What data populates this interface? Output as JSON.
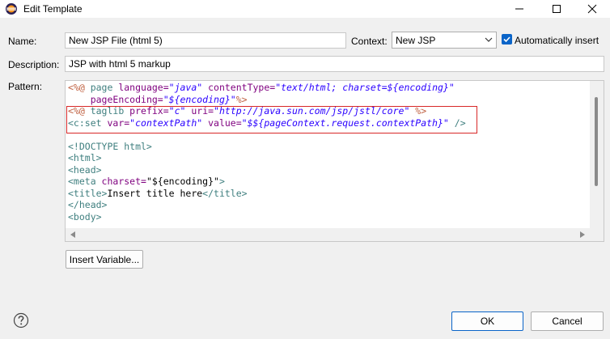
{
  "window": {
    "title": "Edit Template"
  },
  "form": {
    "name_label": "Name:",
    "name_value": "New JSP File (html 5)",
    "context_label": "Context:",
    "context_value": "New JSP",
    "auto_insert_label": "Automatically insert",
    "auto_insert_checked": true,
    "description_label": "Description:",
    "description_value": "JSP with html 5 markup",
    "pattern_label": "Pattern:"
  },
  "pattern": {
    "l1_open": "<%@",
    "l1_page": " page ",
    "l1_lang_attr": "language=",
    "l1_lang_val": "\"java\"",
    "l1_ct_attr": " contentType=",
    "l1_ct_val": "\"text/html; charset=${encoding}\"",
    "l2_indent": "    ",
    "l2_pe_attr": "pageEncoding=",
    "l2_pe_val": "\"${encoding}\"",
    "l2_close": "%>",
    "l3_open": "<%@",
    "l3_taglib": " taglib ",
    "l3_prefix_attr": "prefix=",
    "l3_prefix_val": "\"c\"",
    "l3_uri_attr": " uri=",
    "l3_uri_val": "\"http://java.sun.com/jsp/jstl/core\"",
    "l3_close": " %>",
    "l4_tag": "<c:set",
    "l4_var_attr": " var=",
    "l4_var_val": "\"contextPath\"",
    "l4_value_attr": " value=",
    "l4_value_val": "\"$${pageContext.request.contextPath}\"",
    "l4_close": " />",
    "l6": "<!DOCTYPE html>",
    "l7": "<html>",
    "l8": "<head>",
    "l9_tag": "<meta",
    "l9_attr": " charset=",
    "l9_val": "\"${encoding}\"",
    "l9_close": ">",
    "l10_open": "<title>",
    "l10_text": "Insert title here",
    "l10_close": "</title>",
    "l11": "</head>",
    "l12": "<body>"
  },
  "buttons": {
    "insert_variable": "Insert Variable...",
    "ok": "OK",
    "cancel": "Cancel"
  }
}
